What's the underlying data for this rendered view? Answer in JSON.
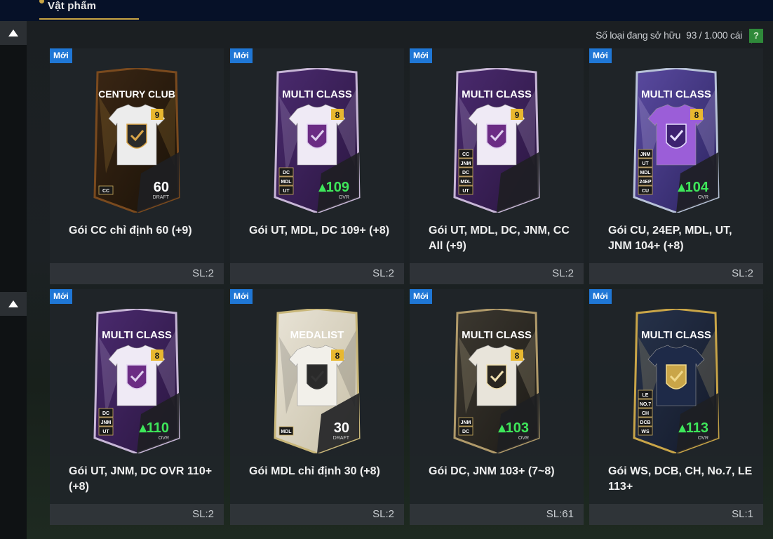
{
  "header": {
    "tab_label": "Vật phẩm"
  },
  "inventory": {
    "ownership_label": "Số loại đang sở hữu",
    "ownership_value": "93 / 1.000 cái",
    "help_label": "?"
  },
  "items": [
    {
      "badge": "Mới",
      "name": "Gói CC chỉ định 60 (+9)",
      "qty": "SL:2",
      "card_title": "CENTURY CLUB",
      "level": "9",
      "rating": "60",
      "rating_label": "DRAFT",
      "tags": [
        "CC"
      ],
      "style": "cc",
      "rating_color": "#ffffff"
    },
    {
      "badge": "Mới",
      "name": "Gói UT, MDL, DC 109+ (+8)",
      "qty": "SL:2",
      "card_title": "MULTI CLASS",
      "level": "8",
      "rating": "109",
      "rating_label": "OVR",
      "tags": [
        "DC",
        "MDL",
        "UT"
      ],
      "style": "multi",
      "rating_color": "#3ee65a"
    },
    {
      "badge": "Mới",
      "name": "Gói UT, MDL, DC, JNM, CC All (+9)",
      "qty": "SL:2",
      "card_title": "MULTI CLASS",
      "level": "9",
      "rating": "",
      "rating_label": "",
      "tags": [
        "CC",
        "JNM",
        "DC",
        "MDL",
        "UT"
      ],
      "style": "multi",
      "rating_color": "#3ee65a"
    },
    {
      "badge": "Mới",
      "name": "Gói CU, 24EP, MDL, UT, JNM 104+ (+8)",
      "qty": "SL:2",
      "card_title": "MULTI CLASS",
      "level": "8",
      "rating": "104",
      "rating_label": "OVR",
      "tags": [
        "JNM",
        "UT",
        "MDL",
        "24EP",
        "CU"
      ],
      "style": "cu",
      "rating_color": "#3ee65a"
    },
    {
      "badge": "Mới",
      "name": "Gói UT, JNM, DC OVR 110+ (+8)",
      "qty": "SL:2",
      "card_title": "MULTI CLASS",
      "level": "8",
      "rating": "110",
      "rating_label": "OVR",
      "tags": [
        "DC",
        "JNM",
        "UT"
      ],
      "style": "multi",
      "rating_color": "#3ee65a"
    },
    {
      "badge": "Mới",
      "name": "Gói MDL chỉ định 30 (+8)",
      "qty": "SL:2",
      "card_title": "MEDALIST",
      "level": "8",
      "rating": "30",
      "rating_label": "DRAFT",
      "tags": [
        "MDL"
      ],
      "style": "mdl",
      "rating_color": "#ffffff"
    },
    {
      "badge": "Mới",
      "name": "Gói DC, JNM 103+ (7~8)",
      "qty": "SL:61",
      "card_title": "MULTI CLASS",
      "level": "8",
      "rating": "103",
      "rating_label": "OVR",
      "tags": [
        "JNM",
        "DC"
      ],
      "style": "dc",
      "rating_color": "#3ee65a"
    },
    {
      "badge": "Mới",
      "name": "Gói WS, DCB, CH, No.7, LE 113+",
      "qty": "SL:1",
      "card_title": "MULTI CLASS",
      "level": "",
      "rating": "113",
      "rating_label": "OVR",
      "tags": [
        "LE",
        "NO.7",
        "CH",
        "DCB",
        "WS"
      ],
      "style": "ws",
      "rating_color": "#3ee65a"
    }
  ]
}
